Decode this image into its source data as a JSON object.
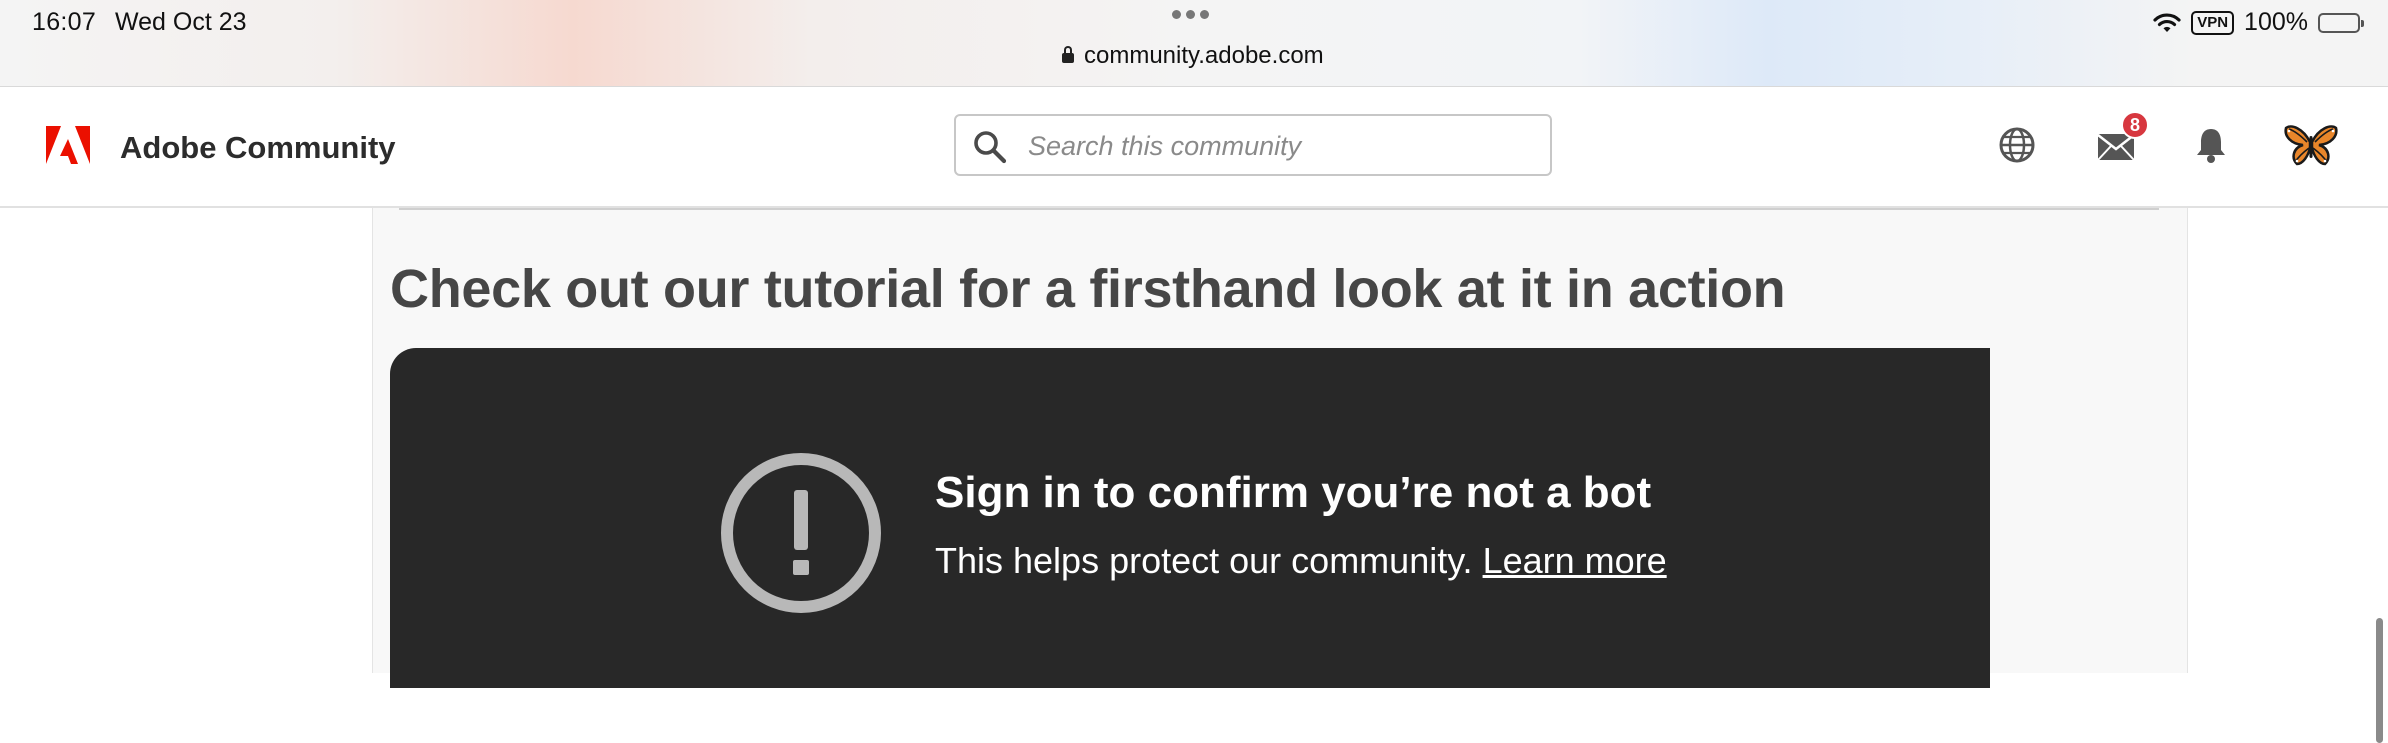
{
  "status_bar": {
    "time": "16:07",
    "date": "Wed Oct 23",
    "url": "community.adobe.com",
    "vpn_label": "VPN",
    "battery": "100%"
  },
  "header": {
    "brand": "Adobe Community",
    "search_placeholder": "Search this community",
    "messages_badge": "8",
    "icons": [
      "adobe-logo-icon",
      "search-icon",
      "globe-icon",
      "mail-icon",
      "bell-icon",
      "butterfly-avatar"
    ]
  },
  "main": {
    "heading": "Check out our tutorial for a firsthand look at it in action",
    "video": {
      "title": "Sign in to confirm you’re not a bot",
      "message": "This helps protect our community.",
      "link": "Learn more"
    }
  },
  "colors": {
    "adobe_red": "#eb1000",
    "badge_red": "#d7373f",
    "video_bg": "#282828",
    "heading": "#464646"
  }
}
